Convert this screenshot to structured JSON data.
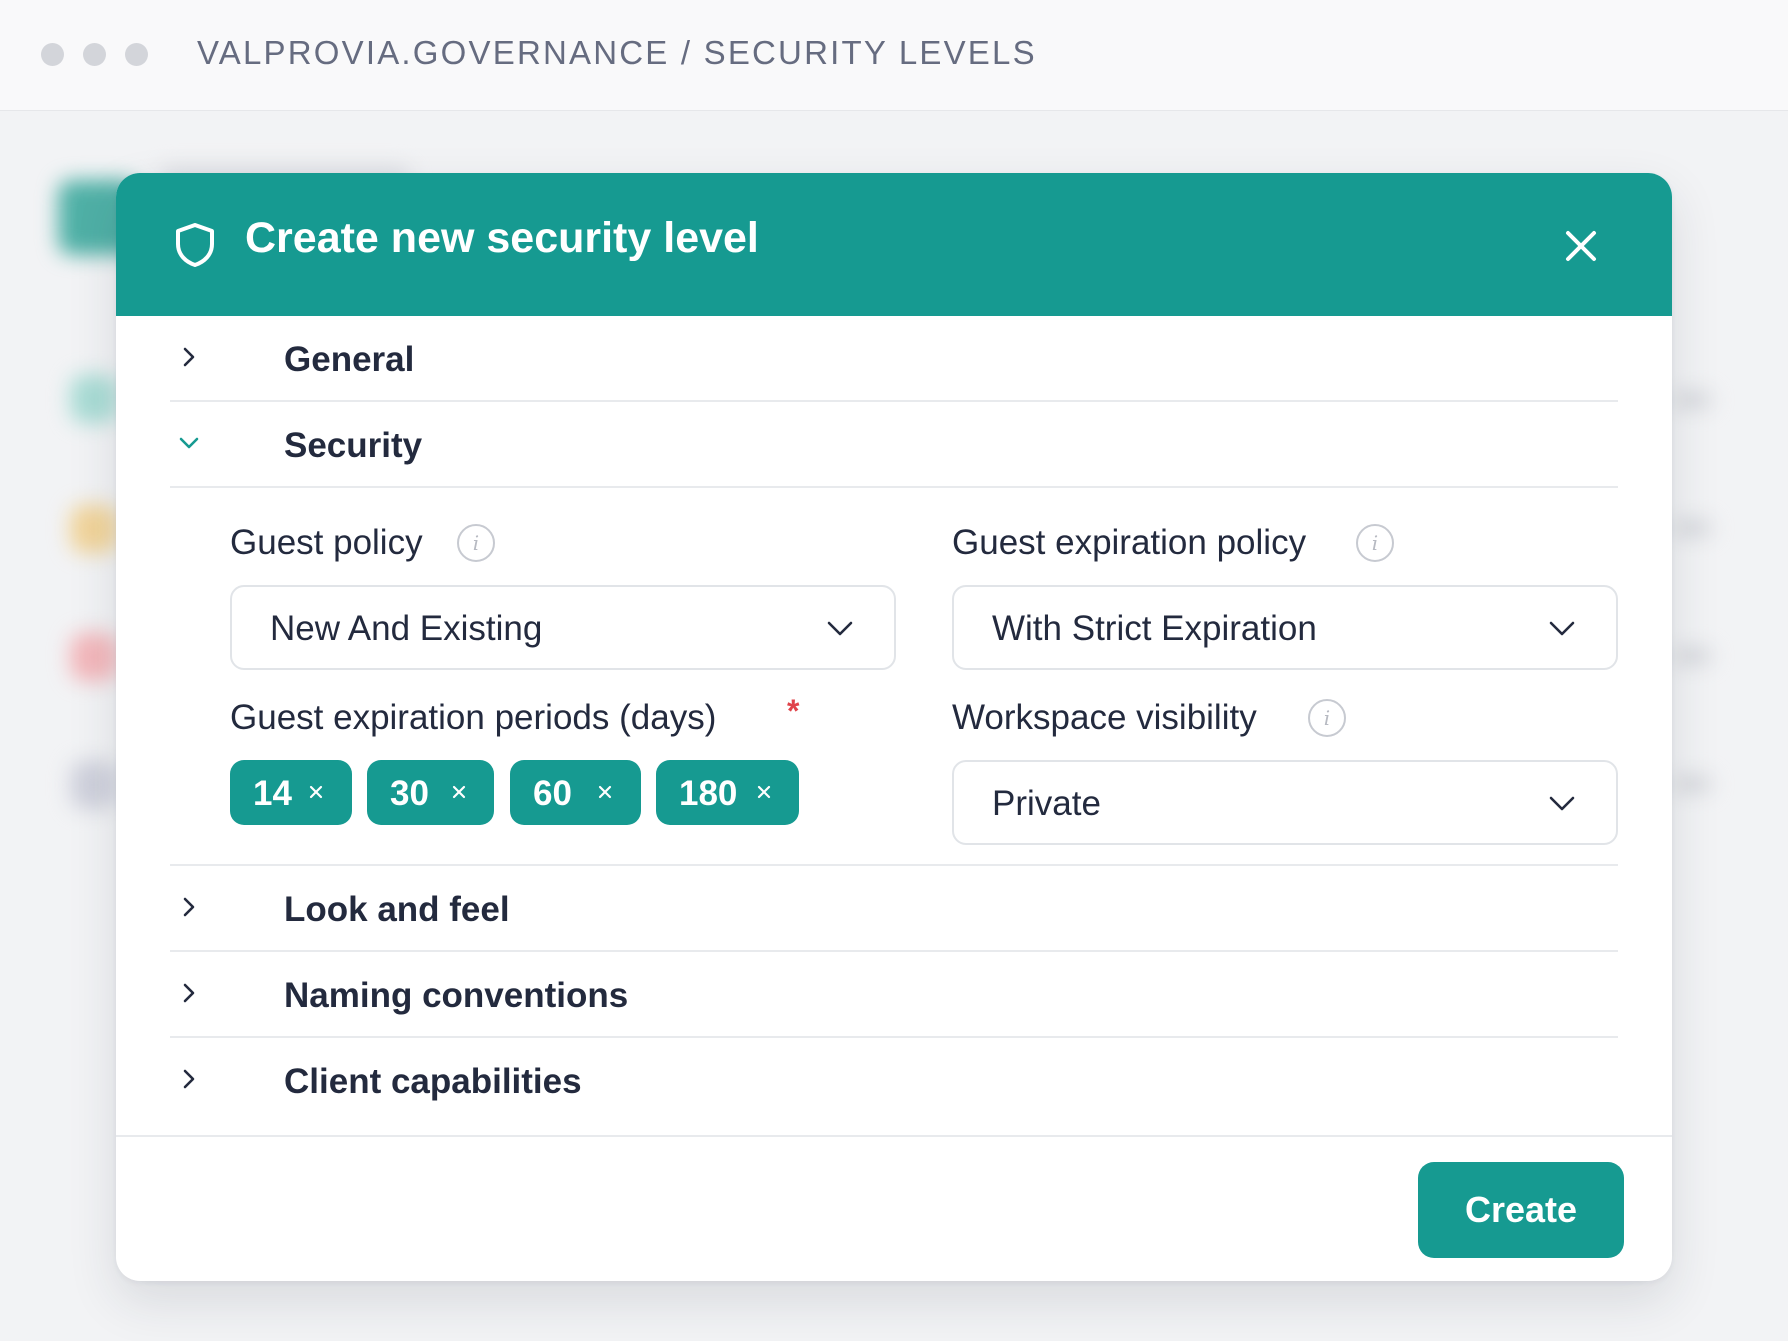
{
  "window": {
    "breadcrumb": "VALPROVIA.GOVERNANCE / SECURITY LEVELS"
  },
  "modal": {
    "title": "Create new security level",
    "sections": [
      {
        "label": "General",
        "expanded": false
      },
      {
        "label": "Security",
        "expanded": true
      },
      {
        "label": "Look and feel",
        "expanded": false
      },
      {
        "label": "Naming conventions",
        "expanded": false
      },
      {
        "label": "Client capabilities",
        "expanded": false
      }
    ],
    "fields": {
      "guest_policy": {
        "label": "Guest policy",
        "value": "New And Existing",
        "info_icon": "i"
      },
      "guest_expiration_policy": {
        "label": "Guest expiration policy",
        "value": "With Strict Expiration",
        "info_icon": "i"
      },
      "guest_expiration_periods": {
        "label": "Guest expiration periods (days)",
        "required_mark": "*",
        "values": [
          "14",
          "30",
          "60",
          "180"
        ]
      },
      "workspace_visibility": {
        "label": "Workspace visibility",
        "value": "Private",
        "info_icon": "i"
      }
    },
    "create_label": "Create"
  },
  "colors": {
    "accent": "#169a91",
    "text": "#232a3e",
    "required": "#e0434a",
    "border": "#e1e4e8"
  }
}
